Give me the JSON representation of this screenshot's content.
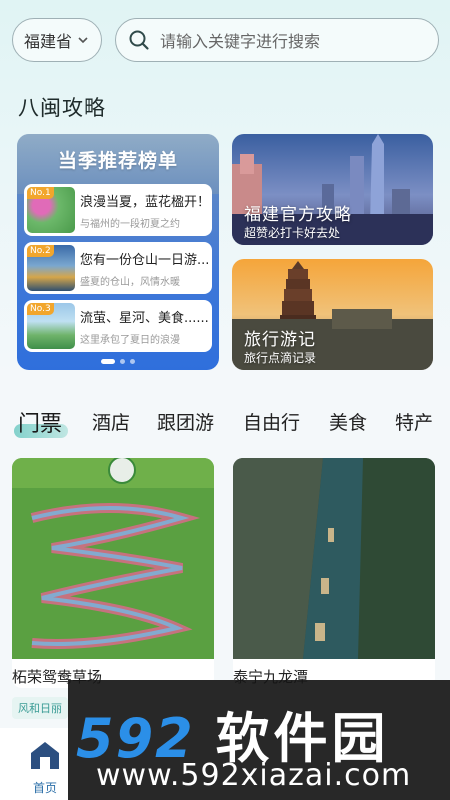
{
  "header": {
    "province": "福建省",
    "search_placeholder": "请输入关键字进行搜索"
  },
  "section": {
    "title": "八闽攻略"
  },
  "ranking": {
    "title": "当季推荐榜单",
    "items": [
      {
        "no": "No.1",
        "name": "浪漫当夏，蓝花楹开！",
        "desc": "与福州的一段初夏之约"
      },
      {
        "no": "No.2",
        "name": "您有一份仓山一日游...",
        "desc": "盛夏的仓山，风情水暖"
      },
      {
        "no": "No.3",
        "name": "流萤、星河、美食......",
        "desc": "这里承包了夏日的浪漫"
      }
    ]
  },
  "guides": [
    {
      "title": "福建官方攻略",
      "sub": "超赞必打卡好去处"
    },
    {
      "title": "旅行游记",
      "sub": "旅行点滴记录"
    }
  ],
  "tabs": [
    "门票",
    "酒店",
    "跟团游",
    "自由行",
    "美食",
    "特产"
  ],
  "products": [
    {
      "name": "柘荣鸳鸯草场",
      "tag": "风和日丽"
    },
    {
      "name": "泰宁九龙潭"
    }
  ],
  "nav": {
    "home": "首页"
  },
  "watermark": {
    "brand_num": "592",
    "brand_cn": "软件园",
    "url": "www.592xiazai.com"
  },
  "colors": {
    "accent": "#39b8ad",
    "rank_blue": "#3f78d8",
    "brand_blue": "#2b8fe8"
  }
}
